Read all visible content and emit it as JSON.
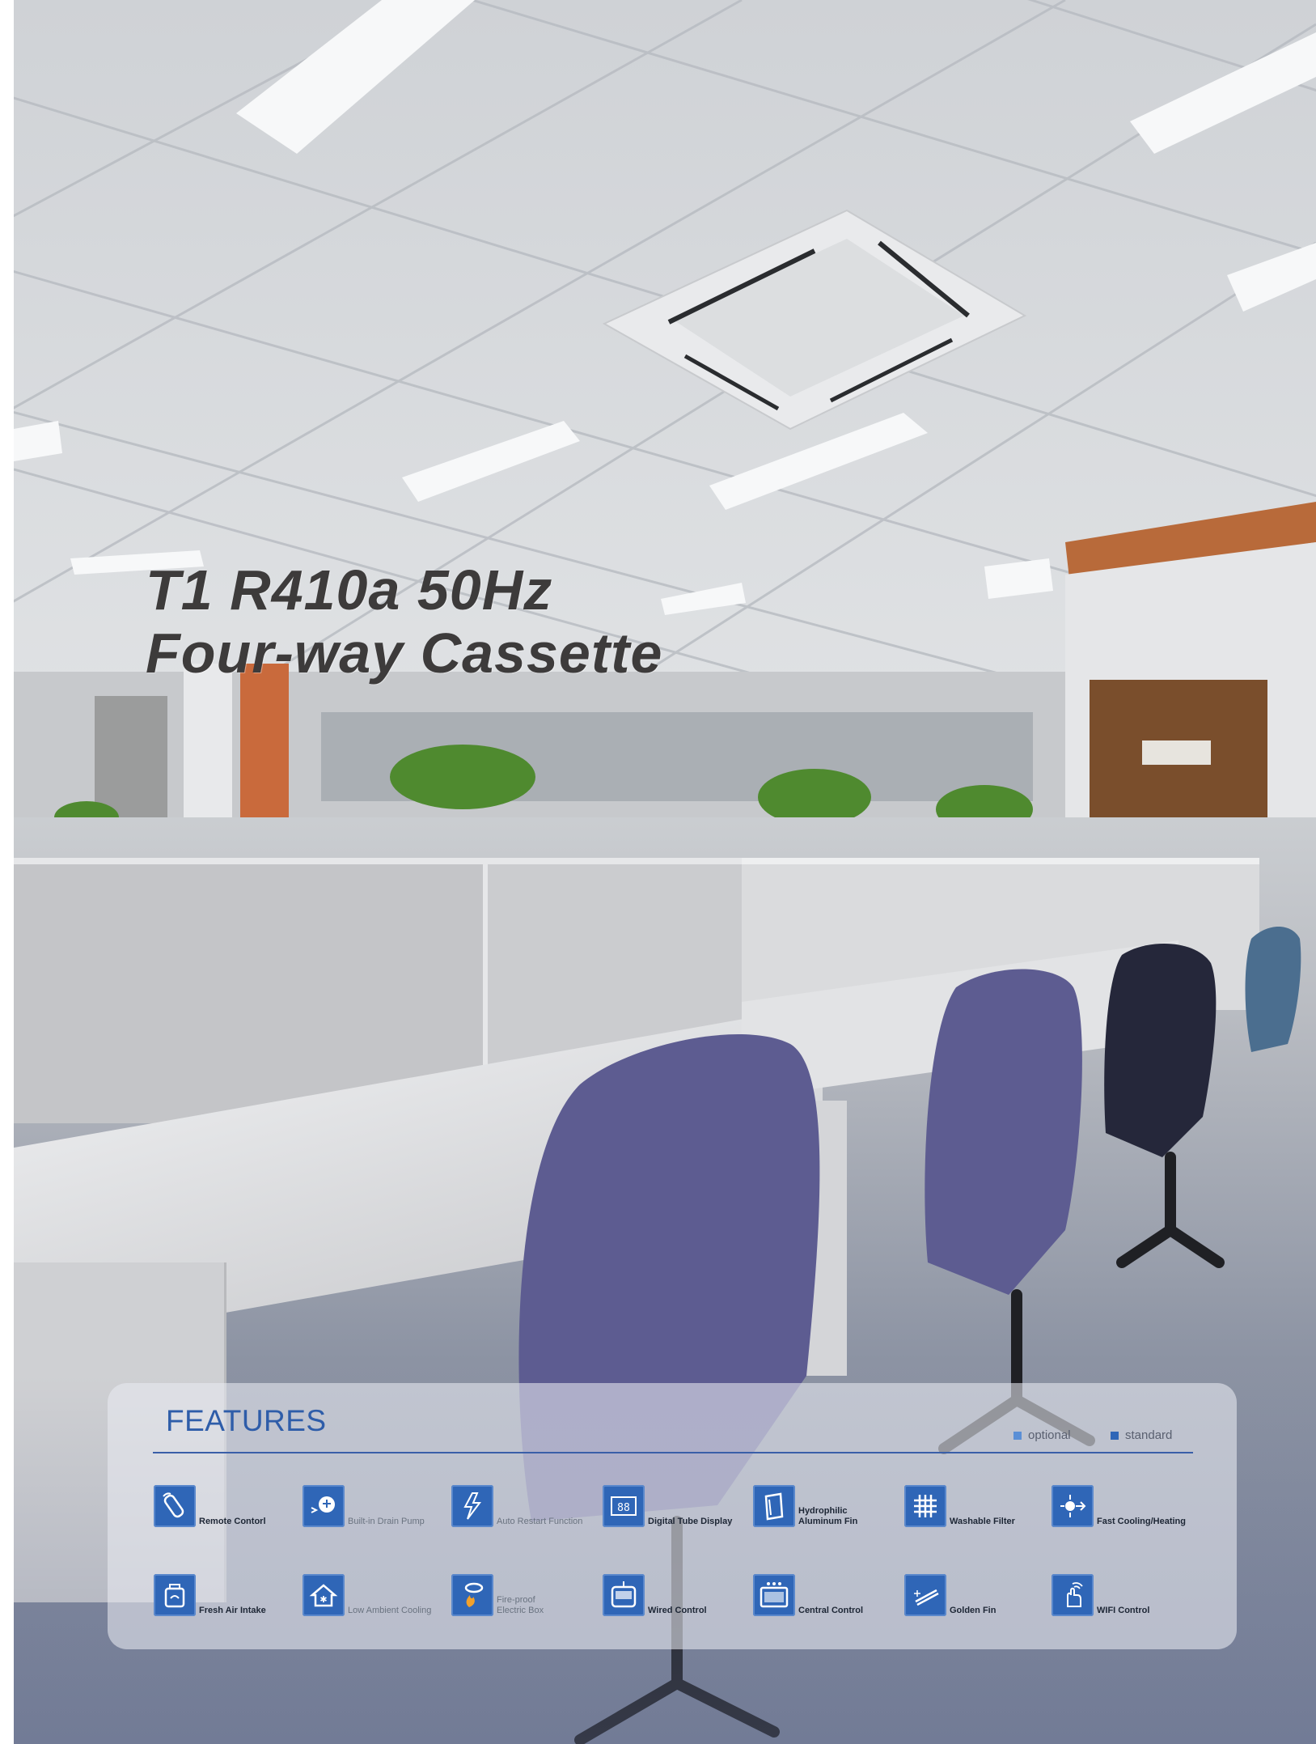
{
  "title": {
    "line1": "T1 R410a 50Hz",
    "line2": "Four-way Cassette"
  },
  "features": {
    "heading": "FEATURES",
    "legend": {
      "optional": {
        "label": "optional",
        "color": "#5b8fd6"
      },
      "standard": {
        "label": "standard",
        "color": "#2f66b7"
      }
    },
    "items": [
      {
        "label": "Remote Contorl",
        "icon": "remote-icon"
      },
      {
        "label": "Built-in Drain Pump",
        "icon": "drain-pump-icon"
      },
      {
        "label": "Auto Restart Function",
        "icon": "auto-restart-icon"
      },
      {
        "label": "Digital Tube Display",
        "icon": "digital-display-icon"
      },
      {
        "label": "Hydrophilic Aluminum Fin",
        "icon": "hydrophilic-fin-icon"
      },
      {
        "label": "Washable Filter",
        "icon": "filter-icon"
      },
      {
        "label": "Fast Cooling/Heating",
        "icon": "fast-cooling-icon"
      },
      {
        "label": "Fresh Air Intake",
        "icon": "fresh-air-icon"
      },
      {
        "label": "Low Ambient Cooling",
        "icon": "low-ambient-icon"
      },
      {
        "label": "Fire-proof Electric Box",
        "icon": "fire-proof-icon"
      },
      {
        "label": "Wired Control",
        "icon": "wired-control-icon"
      },
      {
        "label": "Central Control",
        "icon": "central-control-icon"
      },
      {
        "label": "Golden Fin",
        "icon": "golden-fin-icon"
      },
      {
        "label": "WIFI Control",
        "icon": "wifi-control-icon"
      }
    ]
  }
}
